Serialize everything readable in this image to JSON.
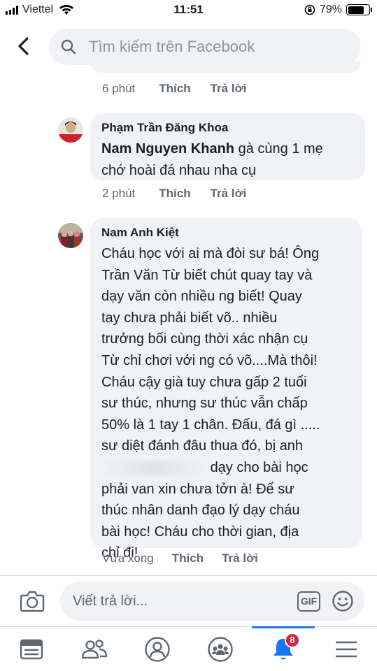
{
  "status_bar": {
    "carrier": "Viettel",
    "time": "11:51",
    "battery_percent": "79%",
    "battery_level": 0.79
  },
  "search": {
    "placeholder": "Tìm kiếm trên Facebook"
  },
  "comments": [
    {
      "time": "6 phút",
      "like_label": "Thích",
      "reply_label": "Trả lời"
    },
    {
      "author": "Phạm Trần Đăng Khoa",
      "mention": "Nam Nguyen Khanh",
      "text_line1_after_mention": "gà cùng 1 mẹ",
      "text_line2": "chớ hoài đá nhau nha cụ",
      "time": "2 phút",
      "like_label": "Thích",
      "reply_label": "Trả lời"
    },
    {
      "author": "Nam Anh Kiệt",
      "lines": [
        "Cháu học với ai mà đòi sư bá! Ông",
        "Trần Văn Từ biết chút quay tay và",
        "dạy văn còn nhiều ng biết! Quay",
        "tay chưa phải biết võ.. nhiều",
        "trưởng bối cùng thời xác nhận cụ",
        "Từ chỉ chơi với ng có võ....Mà thôi!",
        "Cháu cậy già tuy chưa gấp 2 tuổi",
        "sư thúc, nhưng sư thúc vẫn chấp",
        "50% là 1 tay 1 chân. Đấu, đá gì .....",
        "sư diệt đánh đâu thua đó, bị anh"
      ],
      "line_after_blur": "dạy cho bài học",
      "lines_end": [
        "phải van xin chưa tởn à! Để sư",
        "thúc nhân danh đạo lý dạy cháu",
        "bài học! Cháu cho thời gian, địa",
        "chỉ đi!"
      ],
      "time": "Vừa xong",
      "like_label": "Thích",
      "reply_label": "Trả lời"
    }
  ],
  "reply_bar": {
    "placeholder": "Viết trả lời...",
    "gif_label": "GIF"
  },
  "bottom_nav": {
    "notification_count": "8",
    "active_tab": "notifications"
  },
  "colors": {
    "accent": "#1877f2",
    "bubble": "#f0f2f5",
    "badge": "#e41e3f"
  }
}
